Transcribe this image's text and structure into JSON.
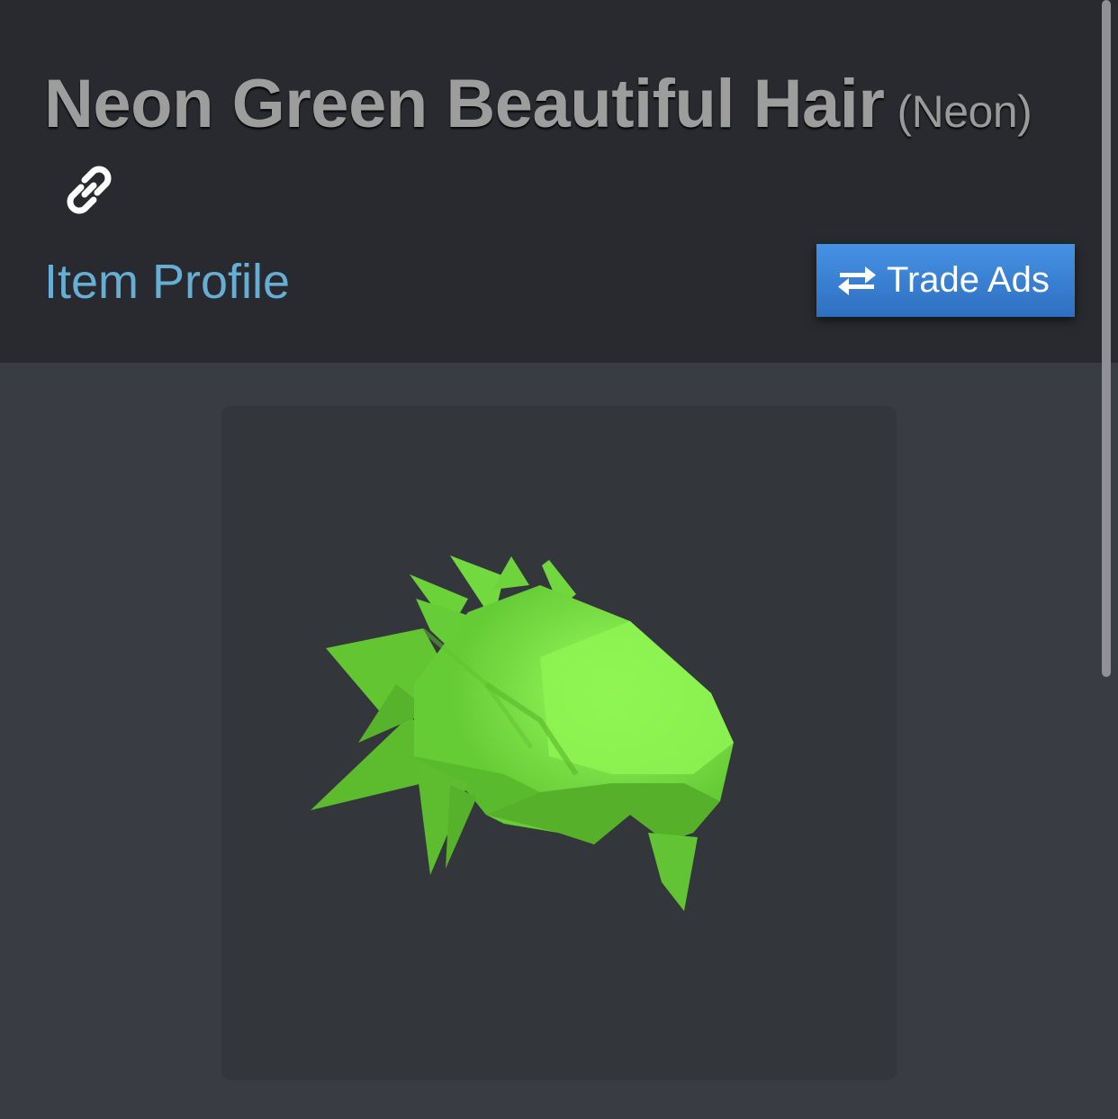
{
  "item": {
    "title": "Neon Green Beautiful Hair",
    "variant": "(Neon)"
  },
  "nav": {
    "item_profile_label": "Item Profile"
  },
  "actions": {
    "trade_ads_label": "Trade Ads"
  },
  "icons": {
    "link": "link-icon",
    "swap": "swap-arrows-icon"
  },
  "colors": {
    "header_bg": "#282a2f",
    "page_bg": "#393c42",
    "panel_bg": "#33363b",
    "link_text": "#67aed4",
    "button_bg": "#3b82d6",
    "hair_green": "#6fd63a"
  }
}
